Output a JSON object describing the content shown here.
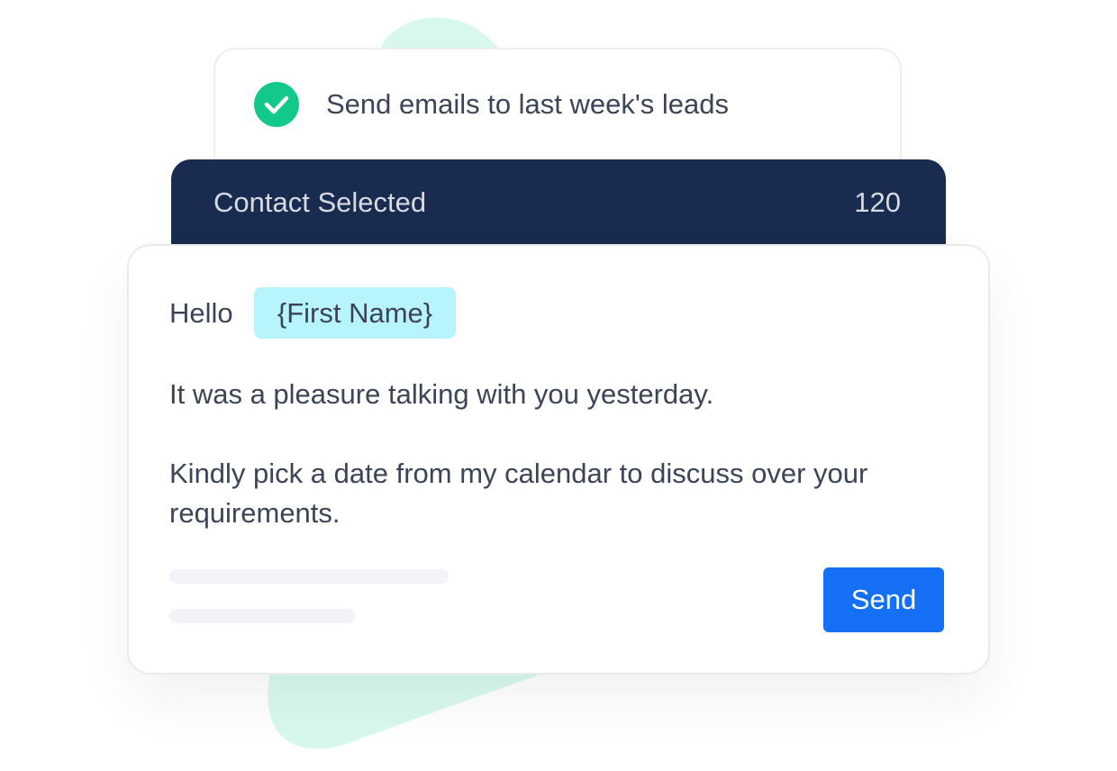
{
  "task": {
    "icon": "check-circle-icon",
    "text": "Send emails to last week's leads",
    "status_color": "#12c98a"
  },
  "contacts": {
    "label": "Contact Selected",
    "count": "120",
    "bar_color": "#1a2b50"
  },
  "email": {
    "greeting": "Hello",
    "token": "{First Name}",
    "token_color": "#b8f4fc",
    "line_1": "It was a pleasure talking with you yesterday.",
    "line_2": "Kindly pick a date from my calendar to discuss over your",
    "line_3": "requirements.",
    "send_label": "Send",
    "send_color": "#1570f5"
  },
  "decor": {
    "blob_color": "#d8f8ee"
  }
}
